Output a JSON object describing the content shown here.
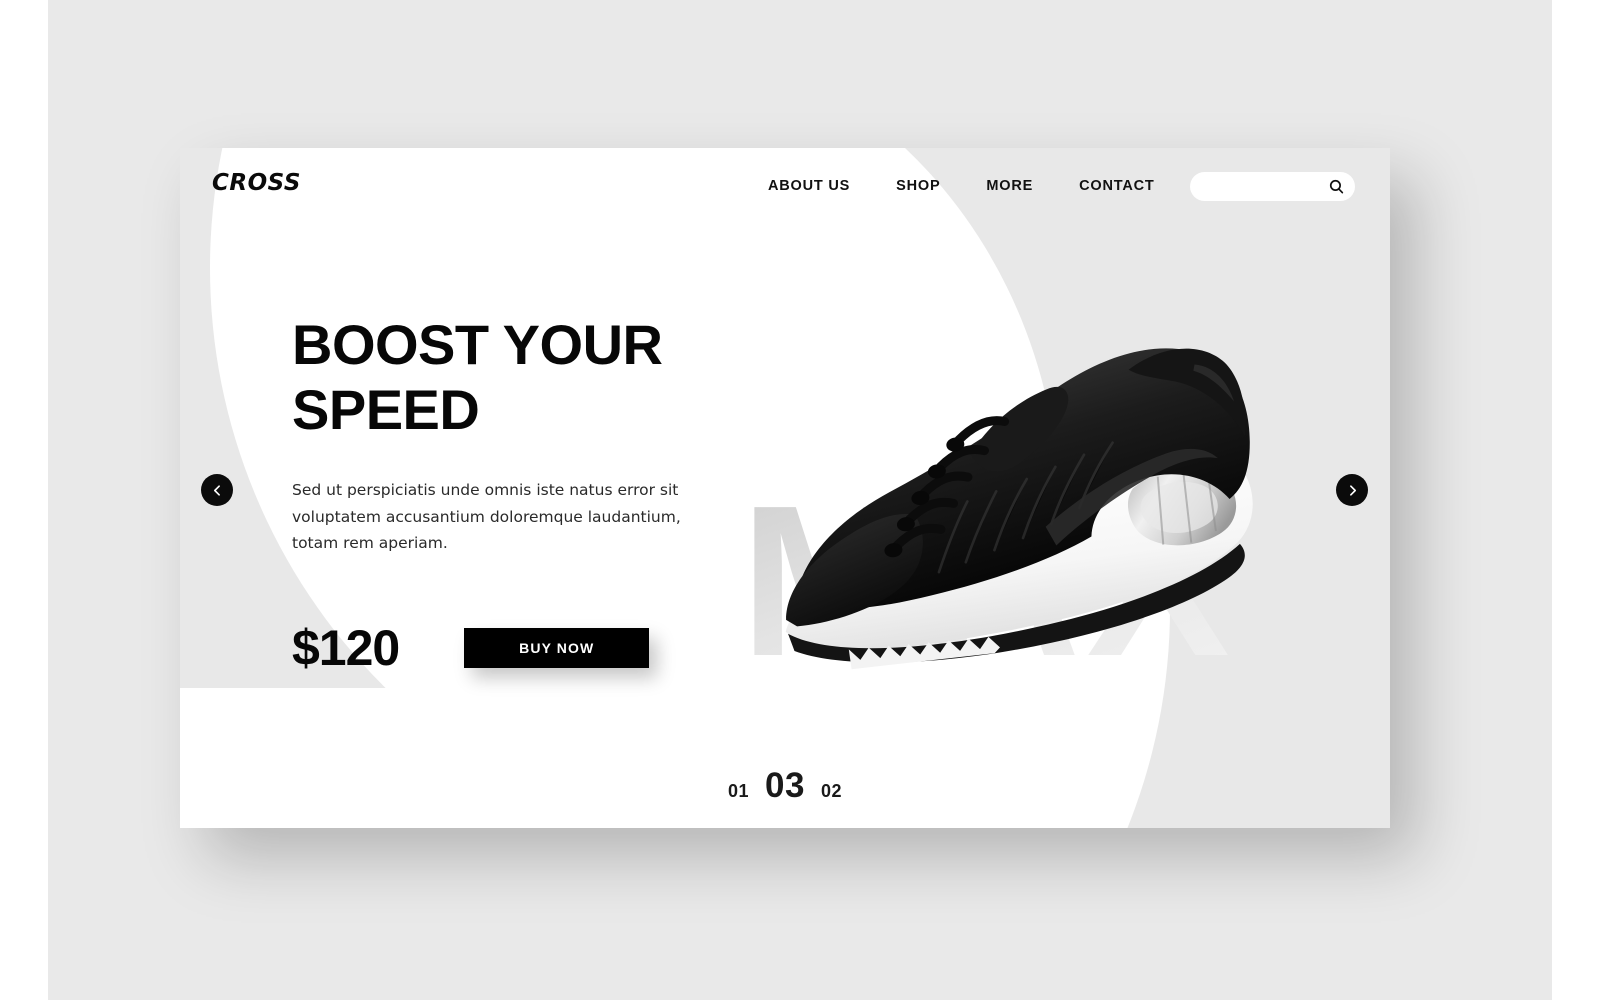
{
  "brand": {
    "logo": "CROSS"
  },
  "nav": {
    "items": [
      {
        "label": "ABOUT US"
      },
      {
        "label": "SHOP"
      },
      {
        "label": "MORE"
      },
      {
        "label": "CONTACT"
      }
    ]
  },
  "search": {
    "value": "",
    "placeholder": "",
    "icon": "search-icon"
  },
  "hero": {
    "headline_line1": "BOOST YOUR",
    "headline_line2": "SPEED",
    "description": "Sed ut perspiciatis unde omnis iste natus error sit voluptatem accusantium doloremque laudantium, totam rem aperiam.",
    "price": "$120",
    "cta_label": "BUY NOW",
    "watermark": "MAX",
    "product_alt": "black running sneaker"
  },
  "carousel": {
    "prev_icon": "chevron-left-icon",
    "next_icon": "chevron-right-icon",
    "slides": [
      {
        "label": "01",
        "active": false
      },
      {
        "label": "03",
        "active": true
      },
      {
        "label": "02",
        "active": false
      }
    ]
  },
  "colors": {
    "page_background": "#ffffff",
    "mat_background": "#e9e9e9",
    "card_background": "#ffffff",
    "shape_gray": "#e8e8e8",
    "accent_black": "#000000",
    "watermark_gray": "#d7d7d7",
    "text_primary": "#070707",
    "text_body": "#2a2a2a"
  }
}
